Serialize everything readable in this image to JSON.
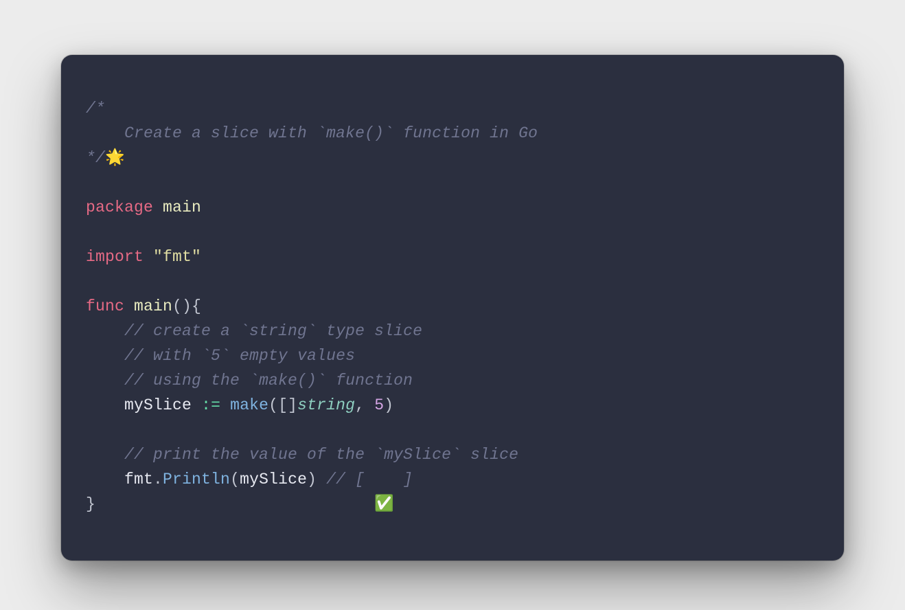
{
  "code": {
    "blockCommentOpen": "/*",
    "blockCommentBody": "    Create a slice with `make()` function in Go",
    "blockCommentClose": "*/",
    "sparkleEmoji": "🌟",
    "kwPackage": "package",
    "pkgName": "main",
    "kwImport": "import",
    "importPath": "\"fmt\"",
    "kwFunc": "func",
    "funcName": "main",
    "funcSigOpen": "()",
    "braceOpen": "{",
    "braceClose": "}",
    "cmtSlice1": "// create a `string` type slice",
    "cmtSlice2": "// with `5` empty values",
    "cmtSlice3": "// using the `make()` function",
    "varMySlice": "mySlice",
    "opDecl": ":=",
    "callMake": "make",
    "parenOpen": "(",
    "parenClose": ")",
    "bracketPair": "[]",
    "typeString": "string",
    "comma": ",",
    "numFive": "5",
    "cmtPrint": "// print the value of the `mySlice` slice",
    "fmtIdent": "fmt",
    "dot": ".",
    "callPrintln": "Println",
    "cmtOutput": "// [    ]",
    "checkEmoji": "✅",
    "indent": "    "
  }
}
